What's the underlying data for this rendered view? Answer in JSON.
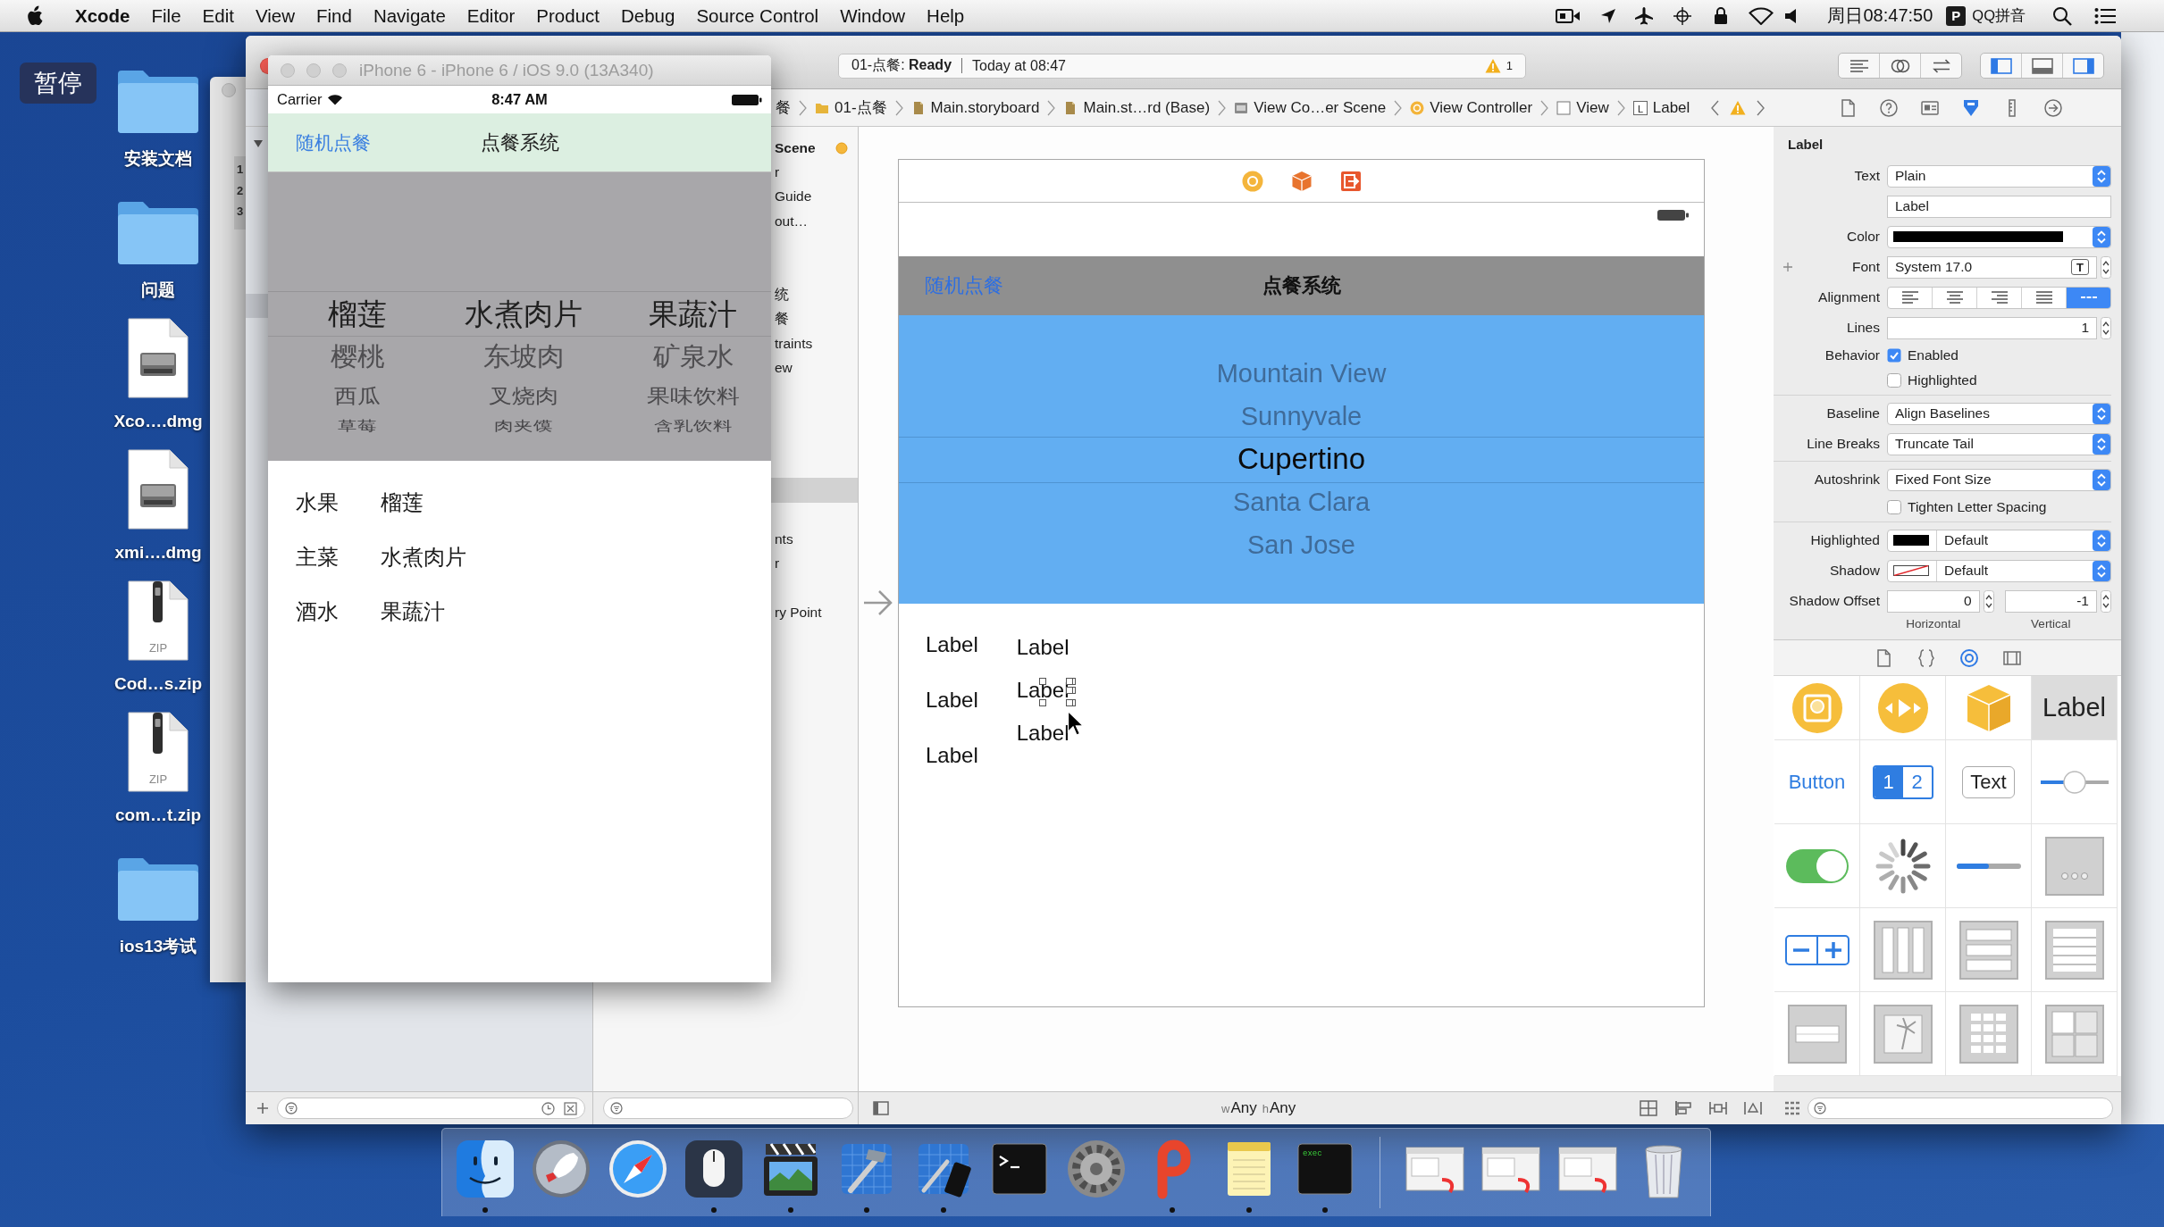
{
  "menu_bar": {
    "app": "Xcode",
    "menus": [
      "File",
      "Edit",
      "View",
      "Find",
      "Navigate",
      "Editor",
      "Product",
      "Debug",
      "Source Control",
      "Window",
      "Help"
    ],
    "clock": "周日08:47:50",
    "input_badge": "P",
    "input_method": "QQ拼音"
  },
  "desktop": {
    "pause_button": "暂停",
    "icons": [
      {
        "kind": "folder",
        "label": "安装文档"
      },
      {
        "kind": "folder",
        "label": "问题"
      },
      {
        "kind": "disk-image",
        "label": "Xco….dmg"
      },
      {
        "kind": "disk-image",
        "label": "xmi….dmg"
      },
      {
        "kind": "archive",
        "label": "Cod…s.zip",
        "tag": "ZIP"
      },
      {
        "kind": "archive",
        "label": "com…t.zip",
        "tag": "ZIP"
      },
      {
        "kind": "folder",
        "label": "ios13考试"
      }
    ]
  },
  "back_window": {
    "line_numbers": [
      "1",
      "2",
      "3"
    ]
  },
  "simulator": {
    "title": "iPhone 6 - iPhone 6 / iOS 9.0 (13A340)",
    "carrier": "Carrier",
    "time": "8:47 AM",
    "nav_bar": {
      "left_button": "随机点餐",
      "title": "点餐系统"
    },
    "picker": [
      {
        "rows": [
          {
            "text": "榴莲",
            "selected": true
          },
          {
            "text": "樱桃",
            "selected": false
          },
          {
            "text": "西瓜",
            "selected": false
          },
          {
            "text": "草莓",
            "selected": false
          }
        ]
      },
      {
        "rows": [
          {
            "text": "水煮肉片",
            "selected": true
          },
          {
            "text": "东坡肉",
            "selected": false
          },
          {
            "text": "叉烧肉",
            "selected": false
          },
          {
            "text": "肉夹馍",
            "selected": false
          }
        ]
      },
      {
        "rows": [
          {
            "text": "果蔬汁",
            "selected": true
          },
          {
            "text": "矿泉水",
            "selected": false
          },
          {
            "text": "果味饮料",
            "selected": false
          },
          {
            "text": "含乳饮料",
            "selected": false
          }
        ]
      }
    ],
    "choices": [
      {
        "category": "水果",
        "value": "榴莲"
      },
      {
        "category": "主菜",
        "value": "水煮肉片"
      },
      {
        "category": "酒水",
        "value": "果蔬汁"
      }
    ]
  },
  "xcode": {
    "toolbar": {
      "status": "01-点餐: **Ready**",
      "time": "Today at 08:47",
      "warnings": "1",
      "editor_modes": [
        {
          "kind": "standard"
        },
        {
          "kind": "assistant"
        },
        {
          "kind": "version"
        }
      ],
      "panels": [
        {
          "kind": "navigator",
          "on": true
        },
        {
          "kind": "debug",
          "on": false
        },
        {
          "kind": "utilities",
          "on": true
        }
      ]
    },
    "jump_bar": [
      {
        "kind": "text",
        "text": "餐"
      },
      {
        "kind": "folder",
        "text": "01-点餐"
      },
      {
        "kind": "storyboard",
        "text": "Main.storyboard"
      },
      {
        "kind": "storyboard",
        "text": "Main.st…rd (Base)"
      },
      {
        "kind": "scene",
        "text": "View Co…er Scene"
      },
      {
        "kind": "controller",
        "text": "View Controller"
      },
      {
        "kind": "view",
        "text": "View"
      },
      {
        "kind": "label",
        "icon_letter": "L",
        "text": "Label"
      }
    ],
    "outline": [
      {
        "kind": "scene",
        "text": "Scene",
        "selected": false
      },
      {
        "kind": "item",
        "text": "r",
        "selected": false
      },
      {
        "kind": "item",
        "text": "Guide",
        "selected": false
      },
      {
        "kind": "item",
        "text": "out…",
        "selected": false
      },
      {
        "kind": "item",
        "selected": false
      },
      {
        "kind": "item",
        "selected": false
      },
      {
        "kind": "item",
        "text": "统",
        "selected": false
      },
      {
        "kind": "item",
        "text": "餐",
        "selected": false
      },
      {
        "kind": "item",
        "text": "traints",
        "selected": false
      },
      {
        "kind": "item",
        "text": "ew",
        "selected": false
      },
      {
        "kind": "item",
        "selected": false
      },
      {
        "kind": "item",
        "selected": false
      },
      {
        "kind": "item",
        "selected": false
      },
      {
        "kind": "item",
        "selected": false
      },
      {
        "kind": "item",
        "selected": true
      },
      {
        "kind": "item",
        "selected": false
      },
      {
        "kind": "item",
        "text": "nts",
        "selected": false
      },
      {
        "kind": "item",
        "text": "r",
        "selected": false
      },
      {
        "kind": "item",
        "selected": false
      },
      {
        "kind": "item",
        "text": "ry Point",
        "selected": false
      }
    ],
    "canvas": {
      "scene": {
        "nav_bar": {
          "left_button": "随机点餐",
          "title": "点餐系统"
        },
        "picker": [
          {
            "text": "Mountain View",
            "selected": false
          },
          {
            "text": "Sunnyvale",
            "selected": false
          },
          {
            "text": "Cupertino",
            "selected": true
          },
          {
            "text": "Santa Clara",
            "selected": false
          },
          {
            "text": "San Jose",
            "selected": false
          }
        ],
        "label_columns": [
          [
            {
              "text": "Label",
              "selected": false
            },
            {
              "text": "Label",
              "selected": false
            },
            {
              "text": "Label",
              "selected": false
            }
          ],
          [
            {
              "text": "Label",
              "selected": false
            },
            {
              "text": "Label",
              "selected": true
            },
            {
              "text": "Label",
              "selected": false
            }
          ]
        ]
      },
      "size_class": [
        {
          "axis": "w",
          "value": "Any"
        },
        {
          "axis": "h",
          "value": "Any"
        }
      ]
    },
    "inspector": {
      "tabs": [
        {
          "kind": "file",
          "selected": false
        },
        {
          "kind": "help",
          "selected": false
        },
        {
          "kind": "identity",
          "selected": false
        },
        {
          "kind": "attributes",
          "selected": true
        },
        {
          "kind": "size",
          "selected": false
        },
        {
          "kind": "connections",
          "selected": false
        }
      ],
      "title": "Label",
      "sections": [
        [
          {
            "kind": "popup",
            "label": "Text",
            "value": "Plain"
          },
          {
            "kind": "field",
            "value": "Label"
          },
          {
            "kind": "color",
            "label": "Color",
            "color": "#000000"
          },
          {
            "kind": "font",
            "label": "Font",
            "value": "System 17.0",
            "button": "T"
          },
          {
            "kind": "alignment",
            "label": "Alignment",
            "options": [
              {
                "kind": "left",
                "selected": false
              },
              {
                "kind": "center",
                "selected": false
              },
              {
                "kind": "right",
                "selected": false
              },
              {
                "kind": "justified",
                "selected": false
              },
              {
                "kind": "natural",
                "selected": true
              }
            ]
          },
          {
            "kind": "stepper",
            "label": "Lines",
            "value": "1"
          },
          {
            "kind": "checkbox",
            "label": "Behavior",
            "text": "Enabled",
            "checked": true
          },
          {
            "kind": "checkbox",
            "text": "Highlighted",
            "checked": false
          }
        ],
        [
          {
            "kind": "popup",
            "label": "Baseline",
            "value": "Align Baselines"
          },
          {
            "kind": "popup",
            "label": "Line Breaks",
            "value": "Truncate Tail"
          }
        ],
        [
          {
            "kind": "popup",
            "label": "Autoshrink",
            "value": "Fixed Font Size"
          },
          {
            "kind": "checkbox",
            "text": "Tighten Letter Spacing",
            "checked": false
          }
        ],
        [
          {
            "kind": "color-popup",
            "label": "Highlighted",
            "color": "#000000",
            "value": "Default"
          },
          {
            "kind": "color-popup",
            "label": "Shadow",
            "value": "Default"
          },
          {
            "kind": "offset",
            "label": "Shadow Offset",
            "fields": [
              {
                "value": "0",
                "caption": "Horizontal"
              },
              {
                "value": "-1",
                "caption": "Vertical"
              }
            ]
          }
        ]
      ]
    },
    "library": {
      "tabs": [
        {
          "kind": "file",
          "selected": false
        },
        {
          "kind": "code",
          "selected": false
        },
        {
          "kind": "object",
          "selected": true
        },
        {
          "kind": "media",
          "selected": false
        }
      ],
      "items": [
        {
          "kind": "view-controller",
          "selected": false
        },
        {
          "kind": "player",
          "selected": false
        },
        {
          "kind": "object",
          "selected": false
        },
        {
          "kind": "label",
          "text": "Label",
          "selected": true
        },
        {
          "kind": "button",
          "text": "Button",
          "selected": false
        },
        {
          "kind": "segmented",
          "segments": [
            "1",
            "2"
          ],
          "selected": false
        },
        {
          "kind": "text-field",
          "text": "Text",
          "selected": false
        },
        {
          "kind": "slider",
          "selected": false
        },
        {
          "kind": "switch",
          "selected": false
        },
        {
          "kind": "activity",
          "selected": false
        },
        {
          "kind": "progress",
          "selected": false
        },
        {
          "kind": "page-control",
          "selected": false
        },
        {
          "kind": "stepper",
          "selected": false
        },
        {
          "kind": "horizontal-stack",
          "selected": false
        },
        {
          "kind": "vertical-stack",
          "selected": false
        },
        {
          "kind": "table",
          "selected": false
        },
        {
          "kind": "table-cell",
          "selected": false
        },
        {
          "kind": "image",
          "selected": false
        },
        {
          "kind": "collection",
          "selected": false
        },
        {
          "kind": "container",
          "selected": false
        }
      ]
    }
  },
  "dock": {
    "apps": [
      {
        "kind": "finder",
        "running": true
      },
      {
        "kind": "launchpad",
        "running": false
      },
      {
        "kind": "safari",
        "running": false
      },
      {
        "kind": "mouse",
        "running": true
      },
      {
        "kind": "movie",
        "running": true
      },
      {
        "kind": "xcode",
        "running": true
      },
      {
        "kind": "simulator",
        "running": true
      },
      {
        "kind": "terminal",
        "running": false
      },
      {
        "kind": "settings",
        "running": false
      },
      {
        "kind": "presenter",
        "running": true
      },
      {
        "kind": "notes",
        "running": true
      },
      {
        "kind": "console",
        "running": true,
        "text": "exec"
      }
    ],
    "documents": [
      {
        "kind": "window"
      },
      {
        "kind": "window"
      },
      {
        "kind": "window"
      },
      {
        "kind": "trash"
      }
    ]
  }
}
